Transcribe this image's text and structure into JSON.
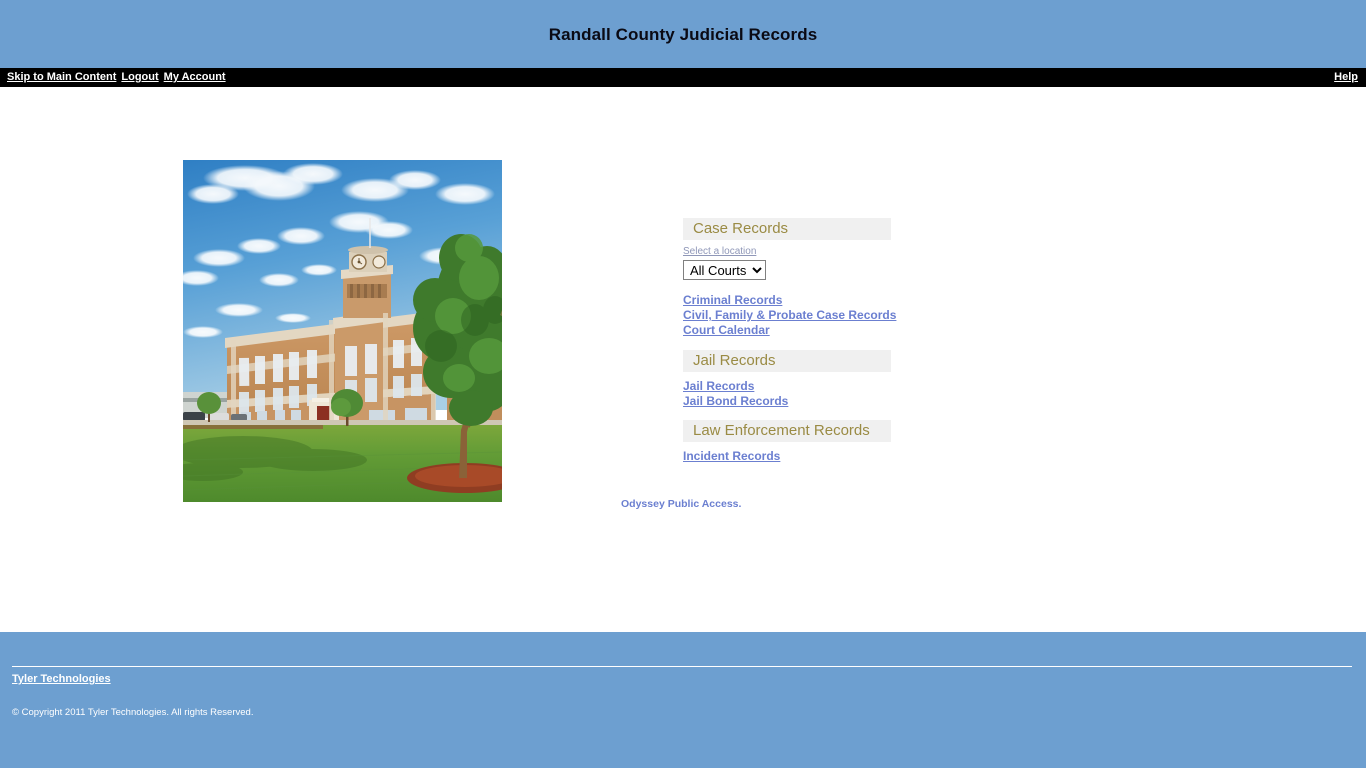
{
  "header": {
    "title": "Randall County Judicial Records",
    "banner_color": "#6d9fd0"
  },
  "nav": {
    "skip_link": "Skip to Main Content",
    "logout_link": "Logout",
    "account_link": "My Account",
    "help_link": "Help",
    "bar_color": "#000000"
  },
  "photo": {
    "alt": "Randall County Courthouse exterior with lawn and tree"
  },
  "records": {
    "sections": [
      {
        "heading": "Case Records",
        "select_label": "Select a location",
        "select_value": "All Courts",
        "select_options": [
          "All Courts"
        ],
        "links": [
          "Criminal Records",
          "Civil, Family & Probate Case Records",
          "Court Calendar"
        ]
      },
      {
        "heading": "Jail Records",
        "links": [
          "Jail Records",
          "Jail Bond Records"
        ]
      },
      {
        "heading": "Law Enforcement Records",
        "links": [
          "Incident Records"
        ]
      }
    ],
    "heading_color": "#9a8b44",
    "heading_bg": "#f0f0f0",
    "link_color": "#6b7fd0"
  },
  "notice": {
    "odyssey": "Odyssey Public Access."
  },
  "footer": {
    "link": "Tyler Technologies",
    "copyright": "© Copyright 2011 Tyler Technologies. All rights Reserved.",
    "bg_color": "#6d9fd0"
  }
}
